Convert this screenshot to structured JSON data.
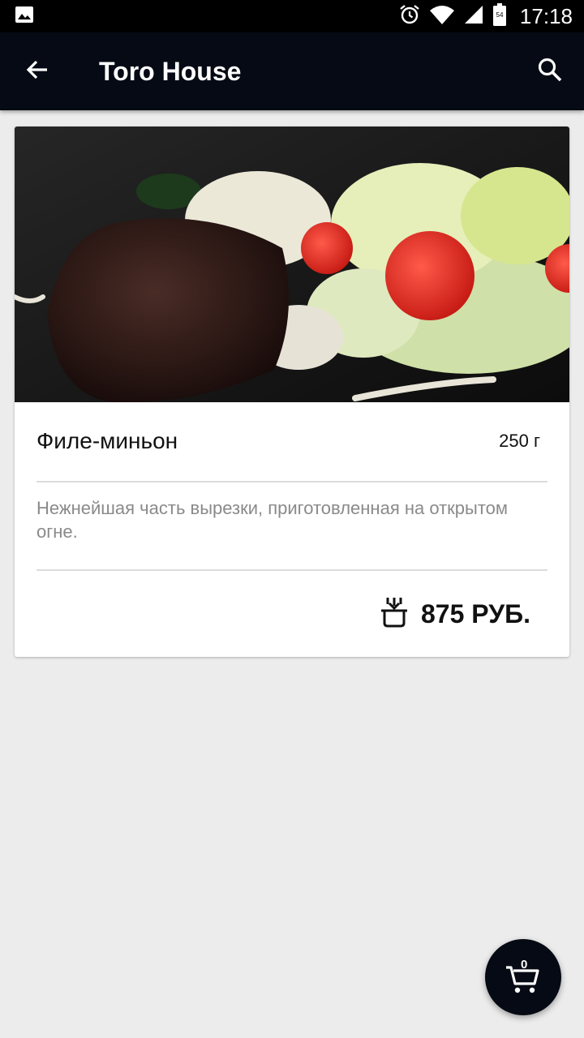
{
  "status_bar": {
    "time": "17:18",
    "battery_level": "54",
    "icons": [
      "image-icon",
      "alarm-icon",
      "wifi-icon",
      "signal-icon",
      "battery-icon"
    ]
  },
  "app_bar": {
    "title": "Toro House",
    "back_icon": "arrow-back-icon",
    "search_icon": "search-icon"
  },
  "dish": {
    "name": "Филе-миньон",
    "weight": "250 г",
    "description": "Нежнейшая часть вырезки, приготовленная на открытом огне.",
    "price": "875 РУБ.",
    "add_icon": "add-to-basket-icon"
  },
  "cart": {
    "count": "0",
    "icon": "cart-icon"
  },
  "colors": {
    "app_bar": "#050a14",
    "background": "#ececec",
    "card": "#ffffff"
  }
}
